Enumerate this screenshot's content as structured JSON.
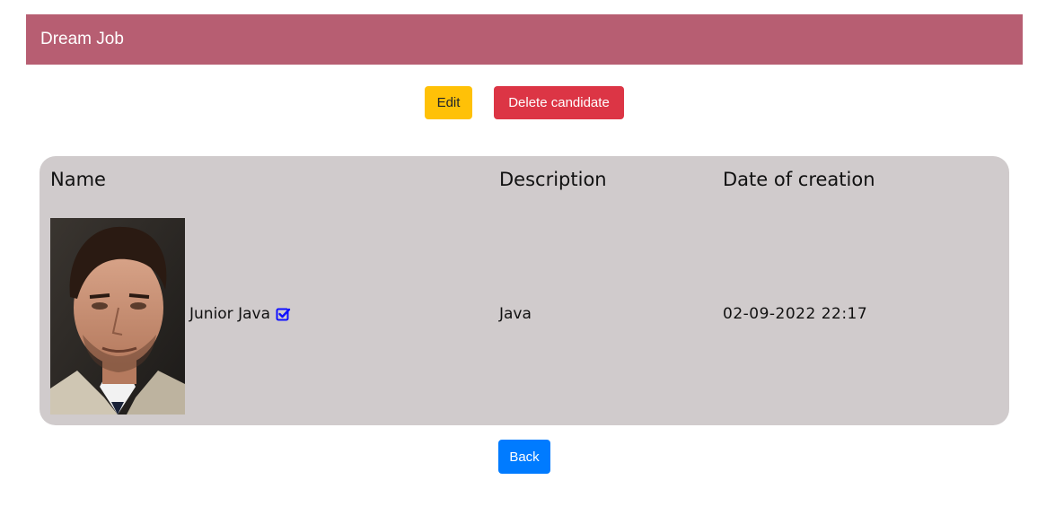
{
  "navbar": {
    "brand": "Dream Job"
  },
  "toolbar": {
    "edit_label": "Edit",
    "delete_label": "Delete candidate"
  },
  "table": {
    "headers": {
      "name": "Name",
      "description": "Description",
      "date": "Date of creation"
    },
    "row": {
      "name": "Junior Java",
      "description": "Java",
      "date": "02-09-2022 22:17",
      "photo_icon": "candidate-photo",
      "status_icon": "checked-box-icon"
    }
  },
  "footer": {
    "back_label": "Back"
  },
  "colors": {
    "navbar": "#b75e72",
    "edit": "#ffc107",
    "delete": "#dc3545",
    "back": "#007bff",
    "card": "#d0cbcc",
    "check": "#1010ff"
  }
}
